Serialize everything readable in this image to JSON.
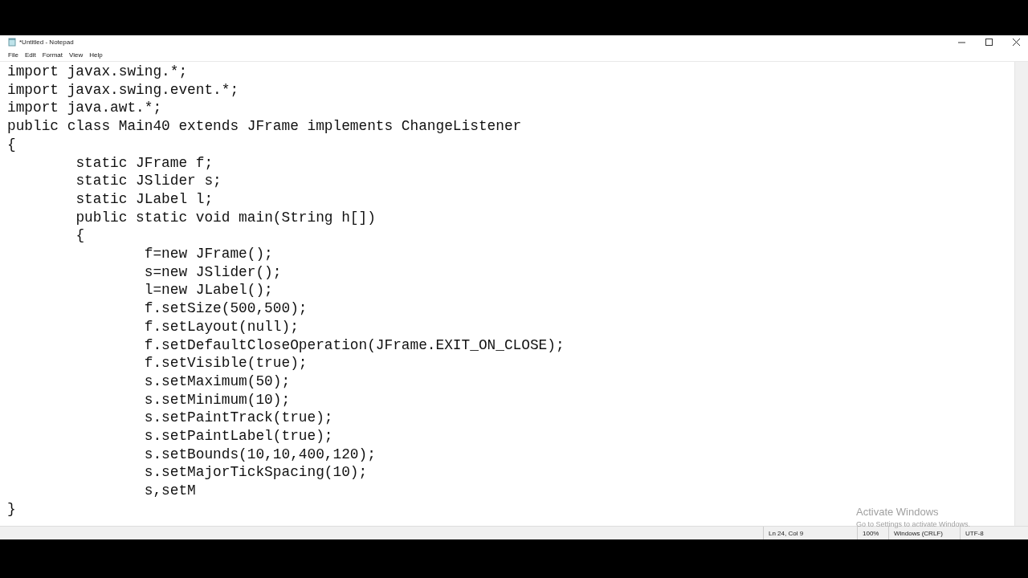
{
  "window": {
    "title": "*Untitled - Notepad"
  },
  "menu": [
    "File",
    "Edit",
    "Format",
    "View",
    "Help"
  ],
  "editor": {
    "lines": [
      "import javax.swing.*;",
      "import javax.swing.event.*;",
      "import java.awt.*;",
      "public class Main40 extends JFrame implements ChangeListener",
      "{",
      "\tstatic JFrame f;",
      "\tstatic JSlider s;",
      "\tstatic JLabel l;",
      "\tpublic static void main(String h[])",
      "\t{",
      "\t\tf=new JFrame();",
      "\t\ts=new JSlider();",
      "\t\tl=new JLabel();",
      "\t\tf.setSize(500,500);",
      "\t\tf.setLayout(null);",
      "\t\tf.setDefaultCloseOperation(JFrame.EXIT_ON_CLOSE);",
      "\t\tf.setVisible(true);",
      "\t\ts.setMaximum(50);",
      "\t\ts.setMinimum(10);",
      "\t\ts.setPaintTrack(true);",
      "\t\ts.setPaintLabel(true);",
      "\t\ts.setBounds(10,10,400,120);",
      "\t\ts.setMajorTickSpacing(10);",
      "\t\ts,setM",
      "}"
    ]
  },
  "activation_notice": {
    "title": "Activate Windows",
    "subtitle": "Go to Settings to activate Windows."
  },
  "status_bar": [
    "Ln 24, Col 9",
    "100%",
    "Windows (CRLF)",
    "UTF-8"
  ]
}
